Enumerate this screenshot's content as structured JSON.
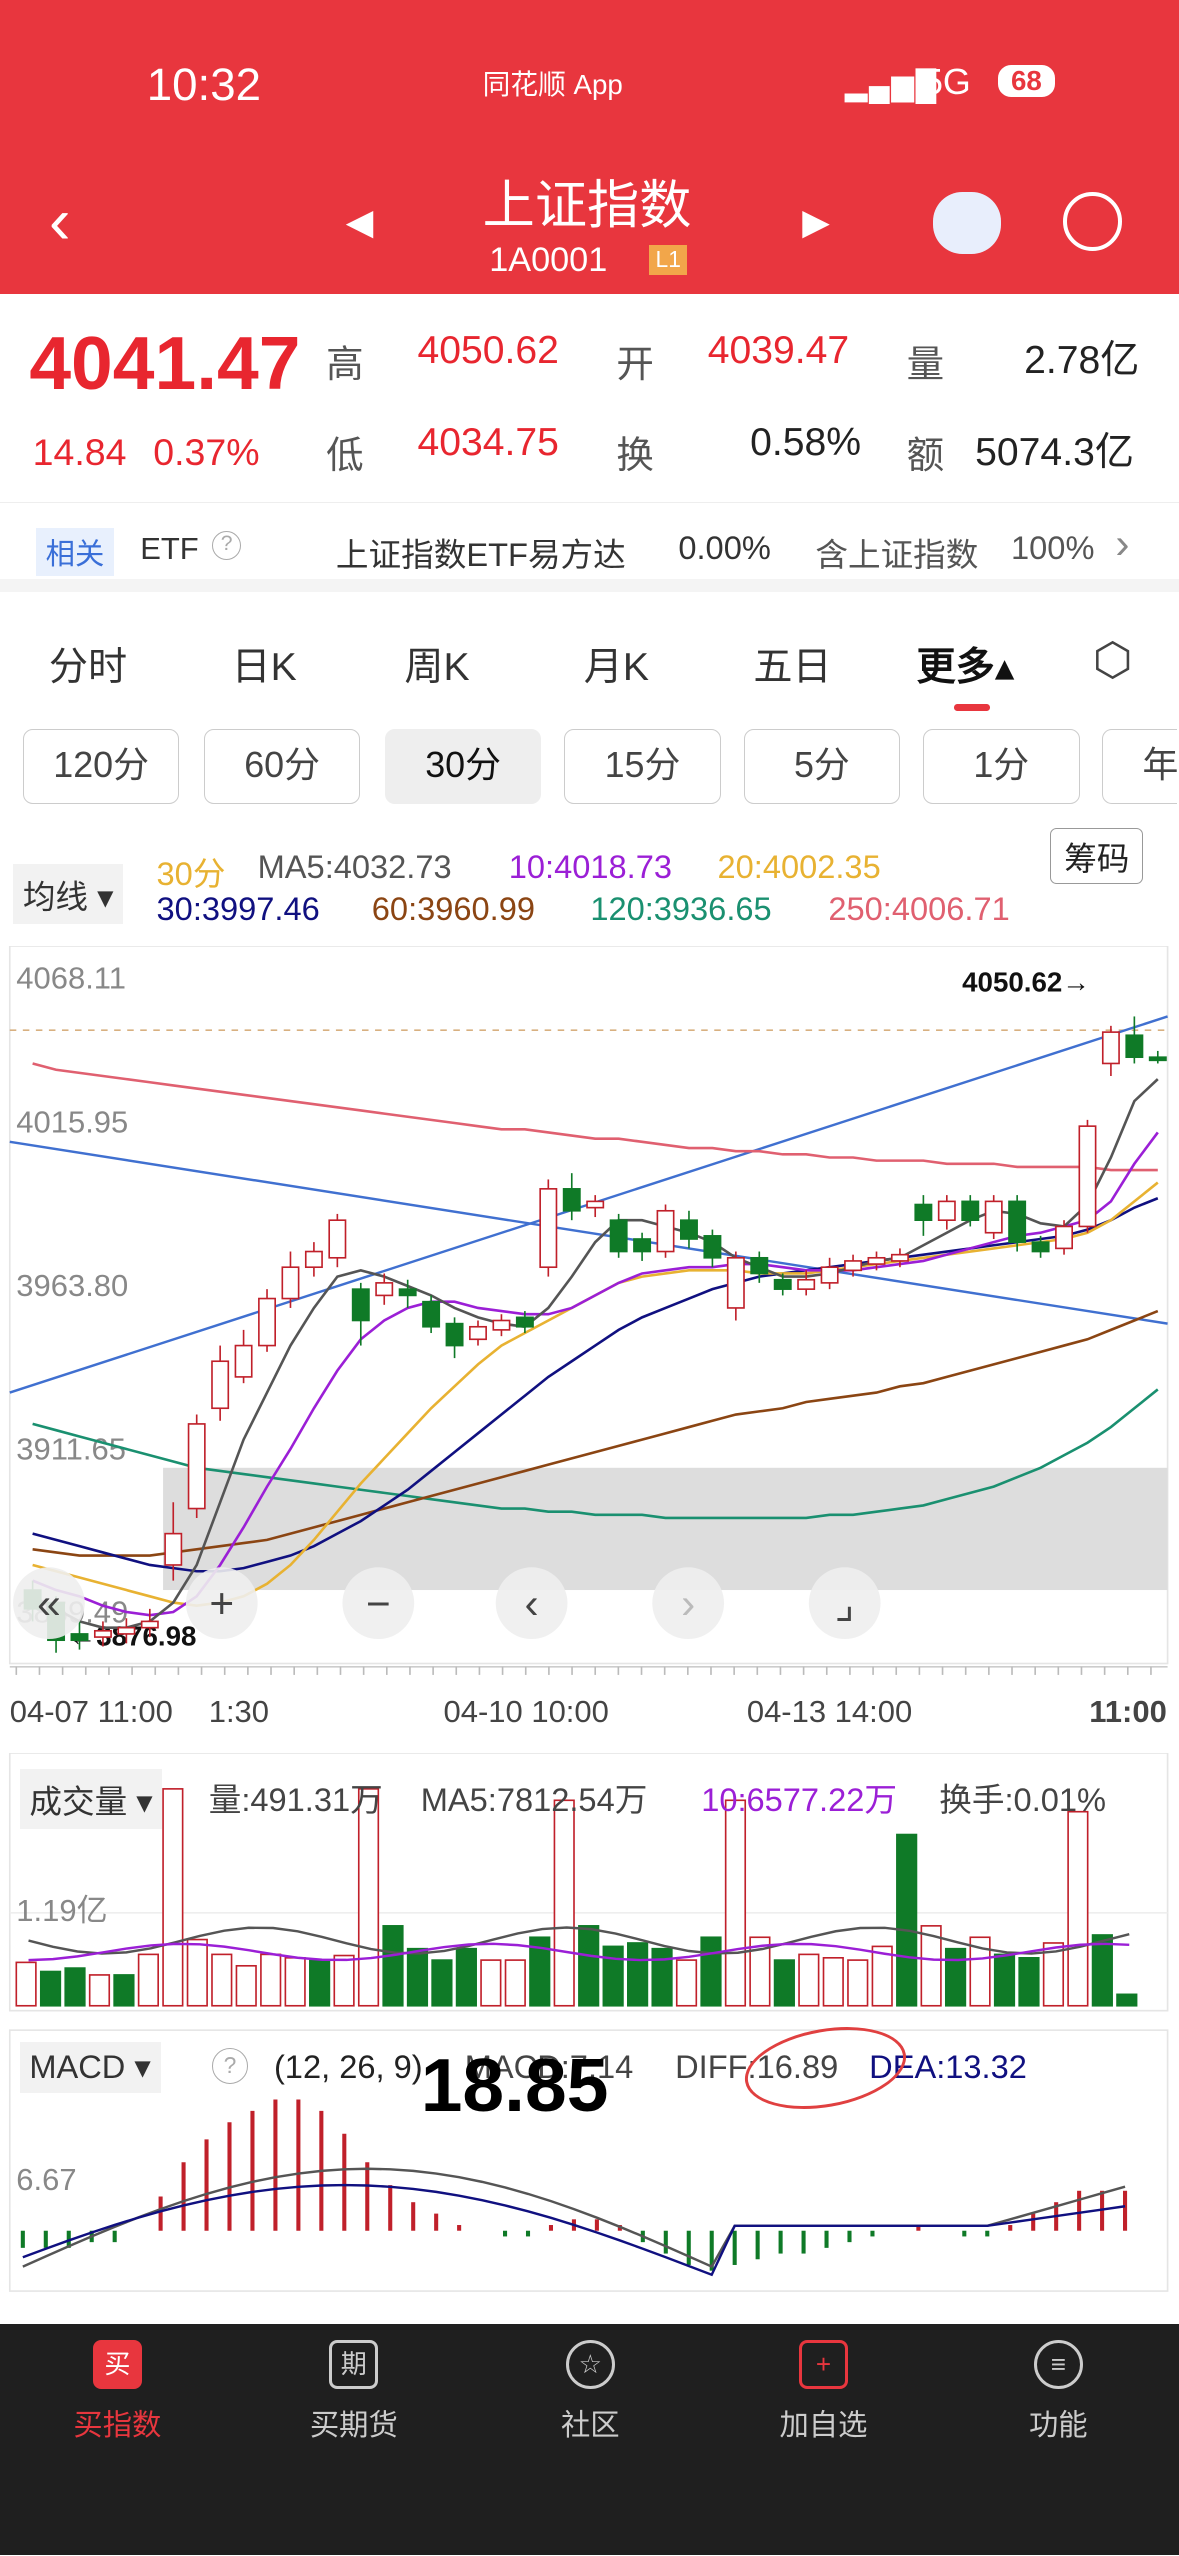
{
  "status": {
    "time": "10:32",
    "app": "同花顺 App",
    "network": "5G",
    "battery": "68"
  },
  "header": {
    "title": "上证指数",
    "code": "1A0001",
    "level": "L1"
  },
  "quote": {
    "price": "4041.47",
    "change": "14.84",
    "pct": "0.37%",
    "high_l": "高",
    "high": "4050.62",
    "open_l": "开",
    "open": "4039.47",
    "vol_l": "量",
    "vol": "2.78亿",
    "low_l": "低",
    "low": "4034.75",
    "turn_l": "换",
    "turn": "0.58%",
    "amt_l": "额",
    "amt": "5074.3亿"
  },
  "related": {
    "tag": "相关",
    "etf": "ETF",
    "q": "?",
    "name": "上证指数ETF易方达",
    "pct": "0.00%",
    "hold": "含上证指数",
    "hold_pct": "100%"
  },
  "tabs": [
    "分时",
    "日K",
    "周K",
    "月K",
    "五日",
    "更多▴"
  ],
  "periods": [
    "120分",
    "60分",
    "30分",
    "15分",
    "5分",
    "1分",
    "年"
  ],
  "ma": {
    "select": "均线 ▾",
    "period": "30分",
    "ma5": "MA5:4032.73",
    "ma10": "10:4018.73",
    "ma20": "20:4002.35",
    "ma30": "30:3997.46",
    "ma60": "60:3960.99",
    "ma120": "120:3936.65",
    "ma250": "250:4006.71",
    "chip": "筹码"
  },
  "colors": {
    "up": "#c0202a",
    "down": "#0f7a27",
    "ma5": "#555555",
    "ma10": "#9b1fd6",
    "ma20": "#e8b232",
    "ma30": "#101080",
    "ma60": "#8b4513",
    "ma120": "#1a9070",
    "ma250": "#e06070"
  },
  "chart_data": {
    "type": "candlestick",
    "y_ticks": [
      "4068.11",
      "4015.95",
      "3963.80",
      "3911.65",
      "3859.49"
    ],
    "ylim": [
      3859.49,
      4068.11
    ],
    "x_ticks": [
      "04-07 11:00",
      "1:30",
      "04-10 10:00",
      "04-13 14:00",
      "11:00"
    ],
    "max_label": "4050.62→",
    "min_label": "←3876.98",
    "candles": [
      [
        3872,
        3866,
        3875,
        3862
      ],
      [
        3868,
        3856,
        3870,
        3852
      ],
      [
        3858,
        3856,
        3862,
        3853
      ],
      [
        3857,
        3859,
        3862,
        3854
      ],
      [
        3858,
        3860,
        3863,
        3855
      ],
      [
        3860,
        3862,
        3866,
        3857
      ],
      [
        3880,
        3890,
        3900,
        3875
      ],
      [
        3898,
        3925,
        3928,
        3895
      ],
      [
        3930,
        3945,
        3950,
        3926
      ],
      [
        3940,
        3950,
        3955,
        3938
      ],
      [
        3950,
        3965,
        3968,
        3948
      ],
      [
        3965,
        3975,
        3980,
        3962
      ],
      [
        3975,
        3980,
        3983,
        3972
      ],
      [
        3978,
        3990,
        3992,
        3975
      ],
      [
        3968,
        3958,
        3970,
        3950
      ],
      [
        3966,
        3970,
        3973,
        3963
      ],
      [
        3968,
        3966,
        3971,
        3962
      ],
      [
        3964,
        3956,
        3966,
        3954
      ],
      [
        3957,
        3950,
        3959,
        3946
      ],
      [
        3952,
        3956,
        3958,
        3950
      ],
      [
        3955,
        3958,
        3960,
        3953
      ],
      [
        3959,
        3956,
        3961,
        3954
      ],
      [
        3975,
        4000,
        4003,
        3972
      ],
      [
        4000,
        3993,
        4005,
        3990
      ],
      [
        3994,
        3996,
        3998,
        3991
      ],
      [
        3990,
        3980,
        3992,
        3978
      ],
      [
        3984,
        3980,
        3986,
        3977
      ],
      [
        3980,
        3993,
        3995,
        3978
      ],
      [
        3990,
        3984,
        3993,
        3981
      ],
      [
        3985,
        3978,
        3987,
        3975
      ],
      [
        3962,
        3978,
        3980,
        3958
      ],
      [
        3978,
        3973,
        3980,
        3970
      ],
      [
        3971,
        3968,
        3973,
        3966
      ],
      [
        3968,
        3971,
        3974,
        3966
      ],
      [
        3970,
        3975,
        3978,
        3968
      ],
      [
        3974,
        3977,
        3979,
        3972
      ],
      [
        3976,
        3978,
        3980,
        3974
      ],
      [
        3977,
        3979,
        3981,
        3975
      ],
      [
        3995,
        3990,
        3998,
        3985
      ],
      [
        3990,
        3996,
        3998,
        3987
      ],
      [
        3996,
        3990,
        3998,
        3988
      ],
      [
        3986,
        3996,
        3998,
        3984
      ],
      [
        3996,
        3983,
        3998,
        3980
      ],
      [
        3983,
        3980,
        3985,
        3978
      ],
      [
        3981,
        3988,
        3990,
        3979
      ],
      [
        3988,
        4020,
        4022,
        3986
      ],
      [
        4040,
        4050,
        4052,
        4036
      ],
      [
        4049,
        4042,
        4055,
        4040
      ],
      [
        4042,
        4041,
        4044,
        4040
      ]
    ],
    "lines": {
      "ma5": [
        3870,
        3866,
        3862,
        3860,
        3860,
        3862,
        3868,
        3880,
        3900,
        3920,
        3935,
        3950,
        3962,
        3972,
        3974,
        3972,
        3969,
        3966,
        3962,
        3959,
        3957,
        3956,
        3962,
        3972,
        3983,
        3990,
        3990,
        3988,
        3986,
        3983,
        3978,
        3975,
        3972,
        3972,
        3973,
        3975,
        3977,
        3978,
        3982,
        3986,
        3990,
        3993,
        3992,
        3989,
        3988,
        3995,
        4010,
        4028,
        4035
      ],
      "ma10": [
        3875,
        3872,
        3870,
        3867,
        3865,
        3864,
        3865,
        3870,
        3880,
        3892,
        3905,
        3917,
        3930,
        3942,
        3952,
        3958,
        3962,
        3964,
        3964,
        3962,
        3961,
        3960,
        3960,
        3962,
        3966,
        3970,
        3973,
        3974,
        3975,
        3975,
        3976,
        3976,
        3975,
        3974,
        3974,
        3974,
        3975,
        3976,
        3977,
        3979,
        3981,
        3983,
        3985,
        3986,
        3988,
        3990,
        3996,
        4008,
        4018
      ],
      "ma20": [
        3880,
        3878,
        3876,
        3874,
        3872,
        3870,
        3868,
        3867,
        3868,
        3870,
        3874,
        3880,
        3888,
        3897,
        3906,
        3914,
        3922,
        3930,
        3937,
        3944,
        3950,
        3954,
        3958,
        3962,
        3966,
        3970,
        3972,
        3973,
        3974,
        3974,
        3974,
        3973,
        3973,
        3973,
        3974,
        3975,
        3976,
        3977,
        3978,
        3979,
        3980,
        3981,
        3982,
        3983,
        3984,
        3986,
        3990,
        3996,
        4002
      ],
      "ma30": [
        3890,
        3888,
        3886,
        3884,
        3882,
        3880,
        3879,
        3878,
        3878,
        3879,
        3881,
        3883,
        3886,
        3890,
        3894,
        3899,
        3904,
        3910,
        3916,
        3922,
        3928,
        3934,
        3940,
        3945,
        3950,
        3955,
        3959,
        3962,
        3965,
        3968,
        3970,
        3972,
        3973,
        3974,
        3975,
        3976,
        3977,
        3978,
        3979,
        3980,
        3981,
        3982,
        3983,
        3984,
        3985,
        3987,
        3990,
        3994,
        3997
      ],
      "ma60": [
        3885,
        3884,
        3883,
        3883,
        3883,
        3883,
        3884,
        3885,
        3886,
        3887,
        3888,
        3890,
        3892,
        3894,
        3896,
        3898,
        3900,
        3902,
        3904,
        3906,
        3908,
        3910,
        3912,
        3914,
        3916,
        3918,
        3920,
        3922,
        3924,
        3926,
        3928,
        3929,
        3930,
        3932,
        3933,
        3934,
        3935,
        3937,
        3938,
        3940,
        3942,
        3944,
        3946,
        3948,
        3950,
        3952,
        3955,
        3958,
        3961
      ],
      "ma120": [
        3925,
        3923,
        3921,
        3919,
        3917,
        3915,
        3913,
        3911,
        3910,
        3909,
        3908,
        3907,
        3906,
        3905,
        3904,
        3903,
        3902,
        3901,
        3900,
        3899,
        3898,
        3898,
        3897,
        3897,
        3896,
        3896,
        3896,
        3895,
        3895,
        3895,
        3895,
        3895,
        3895,
        3895,
        3896,
        3896,
        3897,
        3898,
        3899,
        3901,
        3903,
        3905,
        3908,
        3911,
        3915,
        3919,
        3924,
        3930,
        3936
      ],
      "ma250": [
        4040,
        4038,
        4037,
        4036,
        4035,
        4034,
        4033,
        4032,
        4031,
        4030,
        4029,
        4028,
        4027,
        4026,
        4025,
        4024,
        4023,
        4022,
        4021,
        4020,
        4019,
        4019,
        4018,
        4017,
        4016,
        4016,
        4015,
        4014,
        4013,
        4013,
        4012,
        4012,
        4011,
        4011,
        4010,
        4010,
        4009,
        4009,
        4009,
        4008,
        4008,
        4008,
        4007,
        4007,
        4007,
        4007,
        4006,
        4006,
        4006
      ]
    },
    "volume": {
      "label": "成交量 ▾",
      "vol": "量:491.31万",
      "ma5": "MA5:7812.54万",
      "ma10": "10:6577.22万",
      "turn": "换手:0.01%",
      "tick": "1.19亿",
      "bars": [
        38,
        30,
        33,
        27,
        27,
        45,
        190,
        58,
        45,
        35,
        45,
        42,
        40,
        44,
        190,
        70,
        50,
        40,
        50,
        40,
        40,
        60,
        180,
        70,
        52,
        55,
        50,
        40,
        60,
        180,
        60,
        40,
        45,
        42,
        40,
        52,
        150,
        70,
        50,
        60,
        45,
        42,
        55,
        170,
        62,
        10
      ],
      "up": [
        1,
        0,
        0,
        1,
        0,
        1,
        1,
        1,
        1,
        1,
        1,
        1,
        0,
        1,
        1,
        0,
        0,
        0,
        0,
        1,
        1,
        0,
        1,
        0,
        0,
        0,
        0,
        1,
        0,
        1,
        1,
        0,
        1,
        1,
        1,
        1,
        0,
        1,
        0,
        1,
        0,
        0,
        1,
        1,
        0,
        0
      ]
    },
    "macd": {
      "label": "MACD ▾",
      "q": "?",
      "params": "(12, 26, 9)",
      "macd": "MACD:7.14",
      "diff": "DIFF:16.89",
      "dea": "DEA:13.32",
      "tick": "6.67",
      "overlay": "18.85",
      "bars": [
        -3,
        -3,
        -3,
        -2,
        -2,
        0,
        6,
        12,
        16,
        19,
        21,
        23,
        23,
        21,
        17,
        12,
        8,
        5,
        3,
        1,
        0,
        -1,
        -1,
        1,
        2,
        2,
        1,
        -2,
        -4,
        -6,
        -7,
        -6,
        -5,
        -4,
        -4,
        -3,
        -2,
        -1,
        0,
        1,
        0,
        -1,
        -1,
        1,
        3,
        5,
        7,
        7,
        7
      ]
    }
  },
  "nav": [
    {
      "icon": "买",
      "label": "买指数"
    },
    {
      "icon": "期",
      "label": "买期货"
    },
    {
      "icon": "☆",
      "label": "社区"
    },
    {
      "icon": "+",
      "label": "加自选"
    },
    {
      "icon": "≡",
      "label": "功能"
    }
  ]
}
